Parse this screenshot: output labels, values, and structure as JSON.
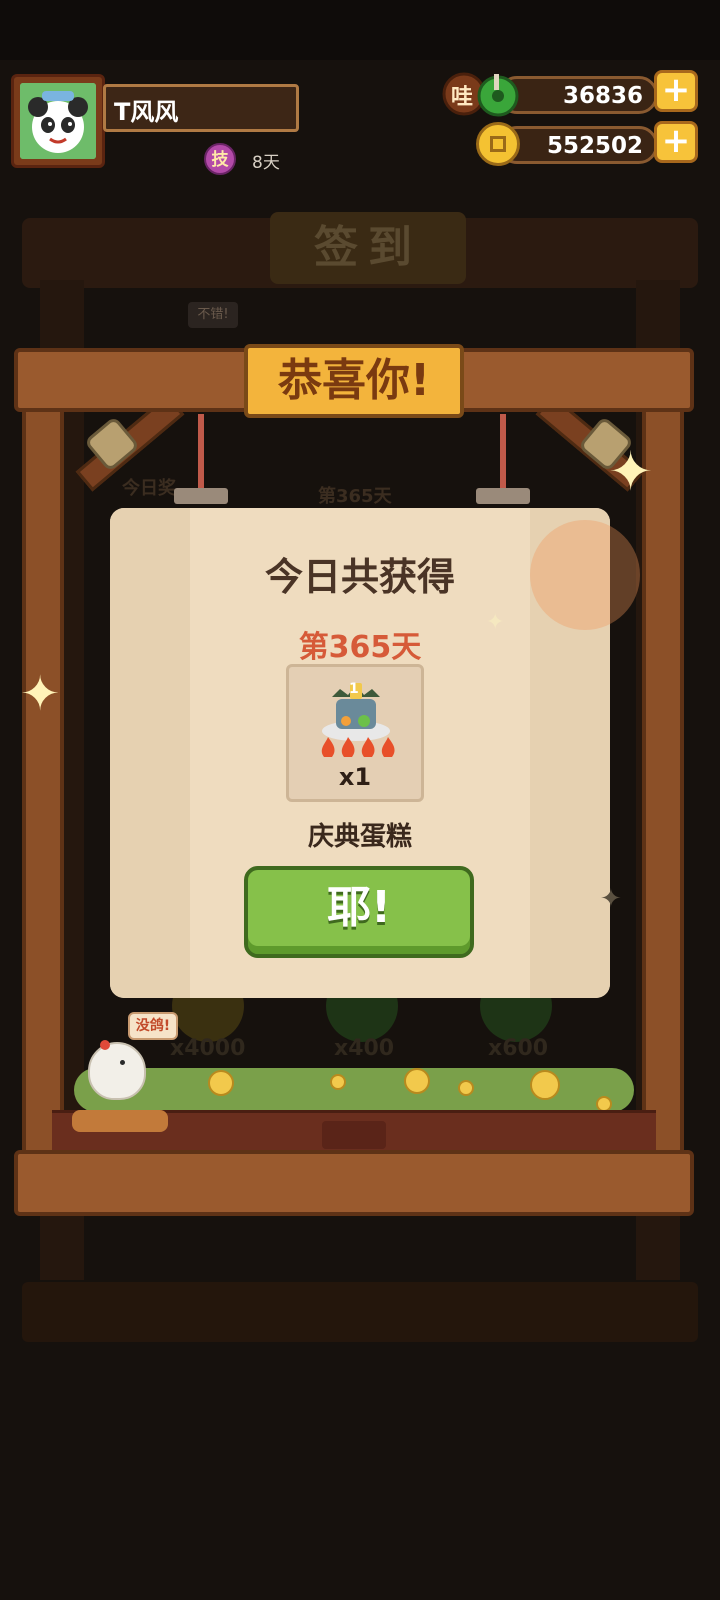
{
  "player": {
    "name": "T风风",
    "skill_badge": "技",
    "days": "8天"
  },
  "resources": {
    "jade_badge": "哇",
    "jade_amount": "36836",
    "coin_amount": "552502",
    "plus_label": "+"
  },
  "background": {
    "board_title": "签到",
    "small_tag": "不错!",
    "today_label": "今日奖",
    "day_label": "第365天",
    "multipliers": [
      "x4000",
      "x400",
      "x600"
    ]
  },
  "frame": {
    "title": "恭喜你!"
  },
  "modal": {
    "title": "今日共获得",
    "day": "第365天",
    "reward": {
      "icon": "celebration-cake-icon",
      "cake_label": "1",
      "quantity": "x1",
      "name": "庆典蛋糕"
    },
    "confirm_label": "耶!"
  },
  "mascot": {
    "speech": "没鸽!"
  },
  "colors": {
    "modal_bg": "#efdcbf",
    "title_gold": "#f3b43c",
    "day_red": "#d65a38",
    "button_green": "#86c14a",
    "wood": "#9a5a2e"
  }
}
